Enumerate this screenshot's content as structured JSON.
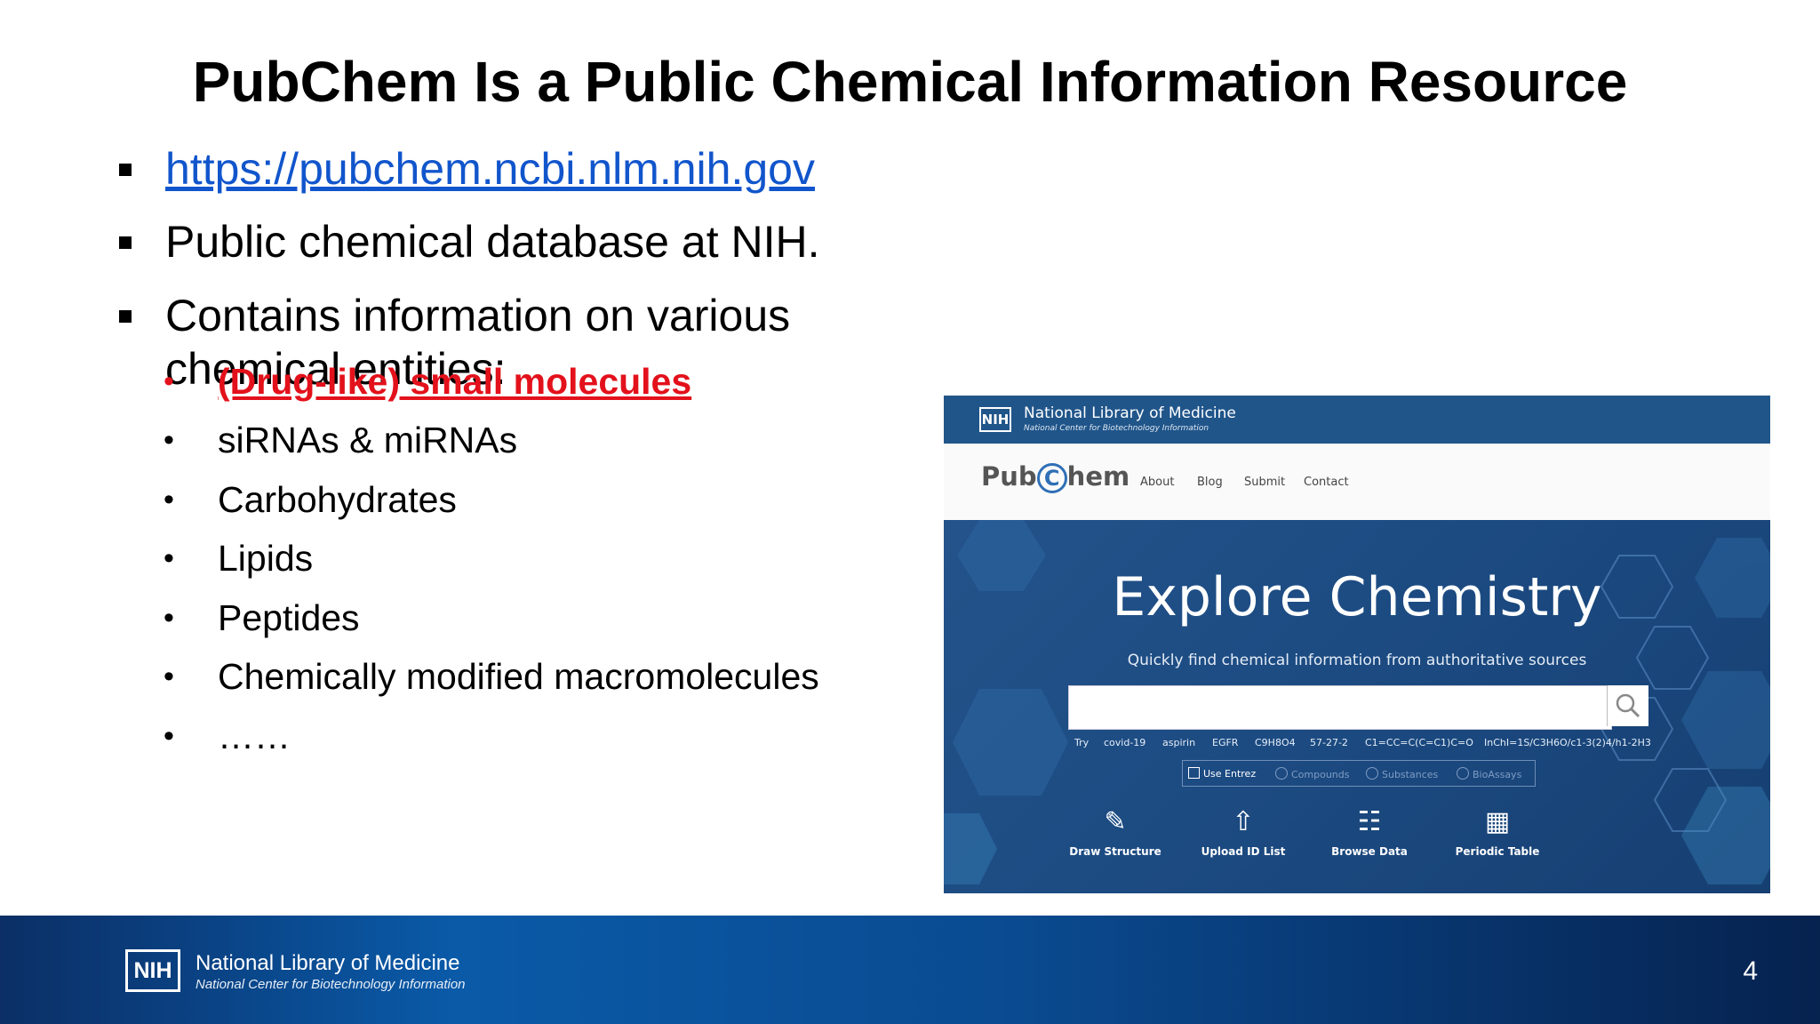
{
  "slide": {
    "title": "PubChem Is a Public Chemical Information Resource",
    "bullets": [
      "https://pubchem.ncbi.nlm.nih.gov",
      "Public chemical database at NIH.",
      "Contains information on various chemical entities:"
    ],
    "sub_bullets": [
      "(Drug-like) small molecules",
      "siRNAs & miRNAs",
      "Carbohydrates",
      "Lipids",
      "Peptides",
      "Chemically modified macromolecules",
      "……"
    ],
    "page_number": "4",
    "colors": {
      "link": "#1155cc",
      "highlight": "#e3111b",
      "footer": "#0a4b91"
    }
  },
  "screenshot": {
    "nlm_logo": "NIH",
    "nlm_name": "National Library of Medicine",
    "nlm_sub": "National Center for Biotechnology Information",
    "logo_pub": "Pub",
    "logo_c": "C",
    "logo_hem": "hem",
    "nav": [
      "About",
      "Blog",
      "Submit",
      "Contact"
    ],
    "hero_title": "Explore Chemistry",
    "hero_subtitle": "Quickly find chemical information from authoritative sources",
    "search_placeholder": "",
    "try_label": "Try",
    "try_examples": [
      "covid-19",
      "aspirin",
      "EGFR",
      "C9H8O4",
      "57-27-2",
      "C1=CC=C(C=C1)C=O",
      "InChI=1S/C3H6O/c1-3(2)4/h1-2H3"
    ],
    "use_entrez": "Use Entrez",
    "options": [
      "Compounds",
      "Substances",
      "BioAssays"
    ],
    "tools": [
      {
        "label": "Draw Structure",
        "icon": "draw-structure-icon"
      },
      {
        "label": "Upload ID List",
        "icon": "upload-icon"
      },
      {
        "label": "Browse Data",
        "icon": "browse-data-icon"
      },
      {
        "label": "Periodic Table",
        "icon": "periodic-table-icon"
      }
    ]
  },
  "footer": {
    "logo": "NIH",
    "name": "National Library of Medicine",
    "sub": "National Center for Biotechnology Information"
  }
}
